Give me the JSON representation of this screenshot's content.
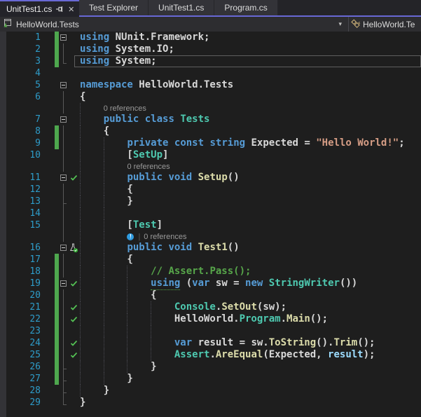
{
  "colors": {
    "accent": "#6868D5",
    "stripBg": "#242428",
    "tabInactive": "#333338",
    "tabActive": "#232329",
    "chromeBg": "#2D2D30",
    "editorBg": "#1E1E1E",
    "marginBg": "#333337",
    "lineNumber": "#2E9CC9",
    "keyword": "#569CD6",
    "type": "#4EC9B0",
    "method": "#DCDCAA",
    "plain": "#D8D8D8",
    "string": "#D69D85",
    "comment": "#57A64A",
    "param": "#9CDCFE",
    "changeBar": "#4EA74E",
    "checkGreen": "#55C455",
    "codelens": "#9A9A9A",
    "foldLine": "#5A5A5A",
    "guide": "#4A4A52",
    "currentLine": "#5F5F5F",
    "info": "#2F9BE0",
    "navText": "#DCDCDC",
    "iconTan": "#D7BA7D"
  },
  "tabs": {
    "active": {
      "label": "UnitTest1.cs",
      "icons": [
        "pin-icon",
        "close-icon"
      ]
    },
    "others": [
      "Test Explorer",
      "UnitTest1.cs",
      "Program.cs"
    ]
  },
  "navbar": {
    "scope_label": "HelloWorld.Tests",
    "scope_icon": "test-file-icon",
    "dropdown_icon": "chevron-down-icon",
    "member_label": "HelloWorld.Te",
    "member_icon": "class-icon",
    "chevron": "▾"
  },
  "editor": {
    "rows": [
      {
        "type": "code",
        "num": 1,
        "fold": "box",
        "change": true,
        "guides": [],
        "segments": [
          [
            "kw",
            "using"
          ],
          [
            "pl",
            " NUnit.Framework;"
          ]
        ]
      },
      {
        "type": "code",
        "num": 2,
        "fold": "line",
        "change": true,
        "guides": [],
        "segments": [
          [
            "kw",
            "using"
          ],
          [
            "pl",
            " System.IO;"
          ]
        ]
      },
      {
        "type": "code",
        "num": 3,
        "fold": "end",
        "change": true,
        "current": true,
        "guides": [],
        "segments": [
          [
            "kw",
            "using"
          ],
          [
            "pl",
            " System;"
          ]
        ]
      },
      {
        "type": "code",
        "num": 4,
        "fold": null,
        "guides": [],
        "segments": []
      },
      {
        "type": "code",
        "num": 5,
        "fold": "box",
        "guides": [],
        "segments": [
          [
            "kw",
            "namespace"
          ],
          [
            "pl",
            " HelloWorld.Tests"
          ]
        ]
      },
      {
        "type": "code",
        "num": 6,
        "fold": "line",
        "guides": [],
        "segments": [
          [
            "pl",
            "{"
          ]
        ]
      },
      {
        "type": "lens",
        "indent": 4,
        "info": false,
        "label": "0 references",
        "fold": "line",
        "guides": [
          0
        ]
      },
      {
        "type": "code",
        "num": 7,
        "fold": "box",
        "guides": [
          0
        ],
        "segments": [
          [
            "pl",
            "    "
          ],
          [
            "kw",
            "public"
          ],
          [
            "pl",
            " "
          ],
          [
            "kw",
            "class"
          ],
          [
            "pl",
            " "
          ],
          [
            "ty",
            "Tests"
          ]
        ]
      },
      {
        "type": "code",
        "num": 8,
        "fold": "line",
        "change": true,
        "guides": [
          0
        ],
        "segments": [
          [
            "pl",
            "    {"
          ]
        ]
      },
      {
        "type": "code",
        "num": 9,
        "fold": "line",
        "change": true,
        "guides": [
          0,
          4
        ],
        "segments": [
          [
            "pl",
            "        "
          ],
          [
            "kw",
            "private"
          ],
          [
            "pl",
            " "
          ],
          [
            "kw",
            "const"
          ],
          [
            "pl",
            " "
          ],
          [
            "kw",
            "string"
          ],
          [
            "pl",
            " Expected = "
          ],
          [
            "st",
            "\"Hello World!\""
          ],
          [
            "pl",
            ";"
          ]
        ]
      },
      {
        "type": "code",
        "num": 10,
        "fold": "line",
        "guides": [
          0,
          4
        ],
        "segments": [
          [
            "pl",
            "        ["
          ],
          [
            "ty",
            "SetUp"
          ],
          [
            "pl",
            "]"
          ]
        ]
      },
      {
        "type": "lens",
        "indent": 8,
        "info": false,
        "label": "0 references",
        "fold": "line",
        "guides": [
          0,
          4
        ]
      },
      {
        "type": "code",
        "num": 11,
        "fold": "box",
        "icon": "check",
        "guides": [
          0,
          4
        ],
        "segments": [
          [
            "pl",
            "        "
          ],
          [
            "kw",
            "public"
          ],
          [
            "pl",
            " "
          ],
          [
            "kw",
            "void"
          ],
          [
            "pl",
            " "
          ],
          [
            "me",
            "Setup"
          ],
          [
            "pl",
            "()"
          ]
        ]
      },
      {
        "type": "code",
        "num": 12,
        "fold": "line",
        "guides": [
          0,
          4
        ],
        "segments": [
          [
            "pl",
            "        {"
          ]
        ]
      },
      {
        "type": "code",
        "num": 13,
        "fold": "endc",
        "guides": [
          0,
          4
        ],
        "segments": [
          [
            "pl",
            "        }"
          ]
        ]
      },
      {
        "type": "code",
        "num": 14,
        "fold": "line",
        "guides": [
          0,
          4
        ],
        "segments": []
      },
      {
        "type": "code",
        "num": 15,
        "fold": "line",
        "guides": [
          0,
          4
        ],
        "segments": [
          [
            "pl",
            "        ["
          ],
          [
            "ty",
            "Test"
          ],
          [
            "pl",
            "]"
          ]
        ]
      },
      {
        "type": "lens",
        "indent": 8,
        "info": true,
        "label": "0 references",
        "fold": "line",
        "guides": [
          0,
          4
        ]
      },
      {
        "type": "code",
        "num": 16,
        "fold": "box",
        "icon": "beaker",
        "guides": [
          0,
          4
        ],
        "segments": [
          [
            "pl",
            "        "
          ],
          [
            "kw",
            "public"
          ],
          [
            "pl",
            " "
          ],
          [
            "kw",
            "void"
          ],
          [
            "pl",
            " "
          ],
          [
            "me",
            "Test1"
          ],
          [
            "pl",
            "()"
          ]
        ]
      },
      {
        "type": "code",
        "num": 17,
        "fold": "line",
        "change": true,
        "guides": [
          0,
          4
        ],
        "segments": [
          [
            "pl",
            "        {"
          ]
        ]
      },
      {
        "type": "code",
        "num": 18,
        "fold": "line",
        "change": true,
        "guides": [
          0,
          4,
          8
        ],
        "segments": [
          [
            "pl",
            "            "
          ],
          [
            "cm",
            "// Assert.Pass();"
          ]
        ]
      },
      {
        "type": "code",
        "num": 19,
        "fold": "box",
        "change": true,
        "icon": "check",
        "guides": [
          0,
          4,
          8
        ],
        "segments": [
          [
            "pl",
            "            "
          ],
          [
            "kwu",
            "using"
          ],
          [
            "pl",
            " ("
          ],
          [
            "kw",
            "var"
          ],
          [
            "pl",
            " sw = "
          ],
          [
            "kw",
            "new"
          ],
          [
            "pl",
            " "
          ],
          [
            "ty",
            "StringWriter"
          ],
          [
            "pl",
            "())"
          ]
        ]
      },
      {
        "type": "code",
        "num": 20,
        "fold": "line",
        "change": true,
        "guides": [
          0,
          4,
          8
        ],
        "segments": [
          [
            "pl",
            "            {"
          ]
        ]
      },
      {
        "type": "code",
        "num": 21,
        "fold": "line",
        "change": true,
        "icon": "check",
        "guides": [
          0,
          4,
          8,
          12
        ],
        "segments": [
          [
            "pl",
            "                "
          ],
          [
            "ty",
            "Console"
          ],
          [
            "pl",
            "."
          ],
          [
            "me",
            "SetOut"
          ],
          [
            "pl",
            "(sw);"
          ]
        ]
      },
      {
        "type": "code",
        "num": 22,
        "fold": "line",
        "change": true,
        "icon": "check",
        "guides": [
          0,
          4,
          8,
          12
        ],
        "segments": [
          [
            "pl",
            "                HelloWorld."
          ],
          [
            "ty",
            "Program"
          ],
          [
            "pl",
            "."
          ],
          [
            "me",
            "Main"
          ],
          [
            "pl",
            "();"
          ]
        ]
      },
      {
        "type": "code",
        "num": 23,
        "fold": "line",
        "change": true,
        "guides": [
          0,
          4,
          8,
          12
        ],
        "segments": []
      },
      {
        "type": "code",
        "num": 24,
        "fold": "line",
        "change": true,
        "icon": "check",
        "guides": [
          0,
          4,
          8,
          12
        ],
        "segments": [
          [
            "pl",
            "                "
          ],
          [
            "kw",
            "var"
          ],
          [
            "pl",
            " result = sw."
          ],
          [
            "me",
            "ToString"
          ],
          [
            "pl",
            "()."
          ],
          [
            "me",
            "Trim"
          ],
          [
            "pl",
            "();"
          ]
        ]
      },
      {
        "type": "code",
        "num": 25,
        "fold": "line",
        "change": true,
        "icon": "check",
        "guides": [
          0,
          4,
          8,
          12
        ],
        "segments": [
          [
            "pl",
            "                "
          ],
          [
            "ty",
            "Assert"
          ],
          [
            "pl",
            "."
          ],
          [
            "me",
            "AreEqual"
          ],
          [
            "pl",
            "(Expected, "
          ],
          [
            "pb",
            "result"
          ],
          [
            "pl",
            ");"
          ]
        ]
      },
      {
        "type": "code",
        "num": 26,
        "fold": "endc",
        "change": true,
        "guides": [
          0,
          4,
          8
        ],
        "segments": [
          [
            "pl",
            "            }"
          ]
        ]
      },
      {
        "type": "code",
        "num": 27,
        "fold": "endc",
        "change": true,
        "guides": [
          0,
          4
        ],
        "segments": [
          [
            "pl",
            "        }"
          ]
        ]
      },
      {
        "type": "code",
        "num": 28,
        "fold": "endc",
        "guides": [
          0
        ],
        "segments": [
          [
            "pl",
            "    }"
          ]
        ]
      },
      {
        "type": "code",
        "num": 29,
        "fold": "end",
        "guides": [],
        "segments": [
          [
            "pl",
            "}"
          ]
        ]
      }
    ]
  }
}
